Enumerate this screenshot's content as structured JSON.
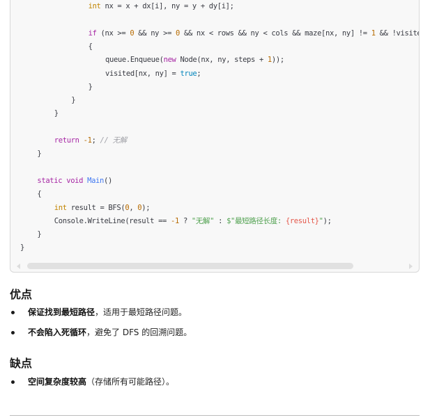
{
  "code_block": {
    "language": "csharp",
    "lines": [
      {
        "indent": 4,
        "tokens": [
          {
            "t": "int",
            "c": "ty"
          },
          {
            "t": " nx = x + dx[i], ny = y + dy[i];",
            "c": ""
          }
        ]
      },
      {
        "indent": 0,
        "tokens": []
      },
      {
        "indent": 4,
        "tokens": [
          {
            "t": "if",
            "c": "kw"
          },
          {
            "t": " (nx >= ",
            "c": ""
          },
          {
            "t": "0",
            "c": "num"
          },
          {
            "t": " && ny >= ",
            "c": ""
          },
          {
            "t": "0",
            "c": "num"
          },
          {
            "t": " && nx < rows && ny < cols && maze[nx, ny] != ",
            "c": ""
          },
          {
            "t": "1",
            "c": "num"
          },
          {
            "t": " && !visited[nx, ny])",
            "c": ""
          }
        ]
      },
      {
        "indent": 4,
        "tokens": [
          {
            "t": "{",
            "c": ""
          }
        ]
      },
      {
        "indent": 5,
        "tokens": [
          {
            "t": "queue.Enqueue(",
            "c": ""
          },
          {
            "t": "new",
            "c": "kw"
          },
          {
            "t": " Node(nx, ny, steps + ",
            "c": ""
          },
          {
            "t": "1",
            "c": "num"
          },
          {
            "t": "));",
            "c": ""
          }
        ]
      },
      {
        "indent": 5,
        "tokens": [
          {
            "t": "visited[nx, ny] = ",
            "c": ""
          },
          {
            "t": "true",
            "c": "bool"
          },
          {
            "t": ";",
            "c": ""
          }
        ]
      },
      {
        "indent": 4,
        "tokens": [
          {
            "t": "}",
            "c": ""
          }
        ]
      },
      {
        "indent": 3,
        "tokens": [
          {
            "t": "}",
            "c": ""
          }
        ]
      },
      {
        "indent": 2,
        "tokens": [
          {
            "t": "}",
            "c": ""
          }
        ]
      },
      {
        "indent": 0,
        "tokens": []
      },
      {
        "indent": 2,
        "tokens": [
          {
            "t": "return",
            "c": "kw"
          },
          {
            "t": " ",
            "c": ""
          },
          {
            "t": "-1",
            "c": "num"
          },
          {
            "t": "; ",
            "c": ""
          },
          {
            "t": "// 无解",
            "c": "cmt"
          }
        ]
      },
      {
        "indent": 1,
        "tokens": [
          {
            "t": "}",
            "c": ""
          }
        ]
      },
      {
        "indent": 0,
        "tokens": []
      },
      {
        "indent": 1,
        "tokens": [
          {
            "t": "static",
            "c": "kw"
          },
          {
            "t": " ",
            "c": ""
          },
          {
            "t": "void",
            "c": "kw"
          },
          {
            "t": " ",
            "c": ""
          },
          {
            "t": "Main",
            "c": "fn"
          },
          {
            "t": "()",
            "c": ""
          }
        ]
      },
      {
        "indent": 1,
        "tokens": [
          {
            "t": "{",
            "c": ""
          }
        ]
      },
      {
        "indent": 2,
        "tokens": [
          {
            "t": "int",
            "c": "ty"
          },
          {
            "t": " result = BFS(",
            "c": ""
          },
          {
            "t": "0",
            "c": "num"
          },
          {
            "t": ", ",
            "c": ""
          },
          {
            "t": "0",
            "c": "num"
          },
          {
            "t": ");",
            "c": ""
          }
        ]
      },
      {
        "indent": 2,
        "tokens": [
          {
            "t": "Console.WriteLine(result == ",
            "c": ""
          },
          {
            "t": "-1",
            "c": "num"
          },
          {
            "t": " ? ",
            "c": ""
          },
          {
            "t": "\"无解\"",
            "c": "str"
          },
          {
            "t": " : ",
            "c": ""
          },
          {
            "t": "$\"最短路径长度: ",
            "c": "str"
          },
          {
            "t": "{result}",
            "c": "interp"
          },
          {
            "t": "\"",
            "c": "str"
          },
          {
            "t": ");",
            "c": ""
          }
        ]
      },
      {
        "indent": 1,
        "tokens": [
          {
            "t": "}",
            "c": ""
          }
        ]
      },
      {
        "indent": 0,
        "tokens": [
          {
            "t": "}",
            "c": ""
          }
        ]
      }
    ]
  },
  "pros": {
    "heading": "优点",
    "items": [
      {
        "bold": "保证找到最短路径",
        "rest": "，适用于最短路径问题。"
      },
      {
        "bold": "不会陷入死循环",
        "rest": "，避免了 DFS 的回溯问题。"
      }
    ]
  },
  "cons": {
    "heading": "缺点",
    "items": [
      {
        "bold": "空间复杂度较高",
        "rest": "（存储所有可能路径）。"
      }
    ]
  },
  "icons": {
    "scroll_left": "caret-left-icon",
    "scroll_right": "caret-right-icon"
  }
}
